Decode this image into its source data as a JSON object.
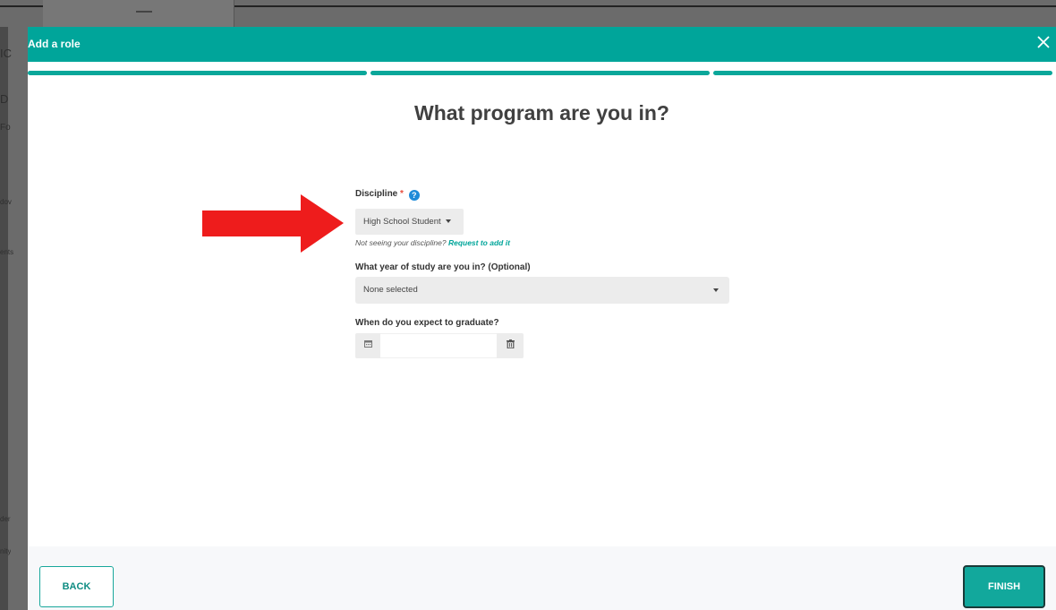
{
  "background_page": {
    "fragments": [
      "IC",
      "D",
      "Fo",
      "dov",
      "ents",
      "der",
      "nity"
    ]
  },
  "modal": {
    "title": "Add a role",
    "close_icon": "close-icon",
    "progress_steps": 3,
    "progress_completed": 3,
    "accent_color": "#00a59a",
    "heading": "What program are you in?"
  },
  "form": {
    "discipline": {
      "label": "Discipline",
      "required_mark": "*",
      "help_icon": "?",
      "selected": "High School Student",
      "hint_text": "Not seeing your discipline? ",
      "hint_link": "Request to add it"
    },
    "year_of_study": {
      "label": "What year of study are you in? (Optional)",
      "selected": "None selected"
    },
    "graduation": {
      "label": "When do you expect to graduate?",
      "value": "",
      "calendar_icon": "calendar-icon",
      "trash_icon": "trash-icon"
    }
  },
  "footer": {
    "back_label": "BACK",
    "finish_label": "FINISH"
  }
}
